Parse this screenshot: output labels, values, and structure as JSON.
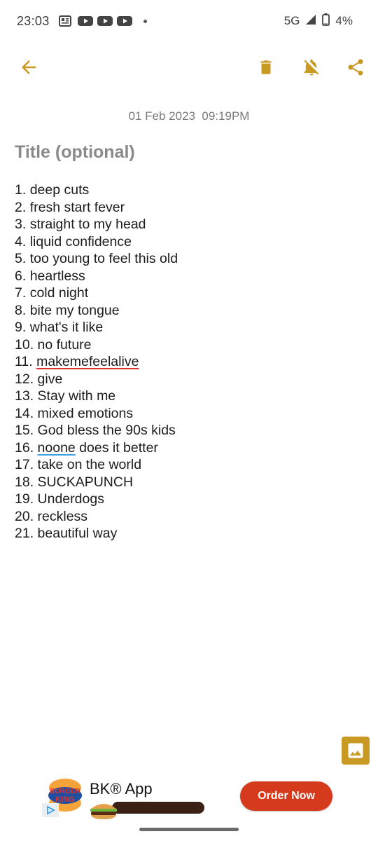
{
  "status_bar": {
    "time": "23:03",
    "notification_icons": [
      "news-icon",
      "youtube-icon",
      "youtube-icon",
      "youtube-icon"
    ],
    "network": "5G",
    "battery": "4%"
  },
  "toolbar": {
    "icons": [
      "back-arrow-icon",
      "trash-icon",
      "bell-off-icon",
      "share-icon"
    ]
  },
  "note": {
    "date": "01 Feb 2023  09:19PM",
    "title_placeholder": "Title (optional)",
    "lines": [
      {
        "num": "1.",
        "text": "deep cuts"
      },
      {
        "num": "2.",
        "text": "fresh start fever"
      },
      {
        "num": "3.",
        "text": "straight to my head"
      },
      {
        "num": "4.",
        "text": "liquid confidence"
      },
      {
        "num": "5.",
        "text": "too young to feel this old"
      },
      {
        "num": "6.",
        "text": "heartless"
      },
      {
        "num": "7.",
        "text": "cold night"
      },
      {
        "num": "8.",
        "text": "bite my tongue"
      },
      {
        "num": "9.",
        "text": "what's it like"
      },
      {
        "num": "10.",
        "text": "no future"
      },
      {
        "num": "11.",
        "text": "makemefeelalive"
      },
      {
        "num": "12.",
        "text": "give"
      },
      {
        "num": "13.",
        "text": "Stay with me"
      },
      {
        "num": "14.",
        "text": "mixed emotions"
      },
      {
        "num": "15.",
        "text": "God bless the 90s kids"
      },
      {
        "num": "16.",
        "text_underlined": "noone",
        "text_rest": " does it better"
      },
      {
        "num": "17.",
        "text": "take on the world"
      },
      {
        "num": "18.",
        "text": "SUCKAPUNCH"
      },
      {
        "num": "19.",
        "text": "Underdogs"
      },
      {
        "num": "20.",
        "text": "reckless"
      },
      {
        "num": "21.",
        "text": "beautiful way"
      }
    ]
  },
  "ad": {
    "brand_logo_line1": "BURGER",
    "brand_logo_line2": "KING",
    "title": "BK® App",
    "cta": "Order Now"
  },
  "colors": {
    "accent": "#C99A23",
    "cta": "#D63A1D",
    "spell_error": "#E0332F",
    "grammar_hint": "#3AA0E0"
  }
}
